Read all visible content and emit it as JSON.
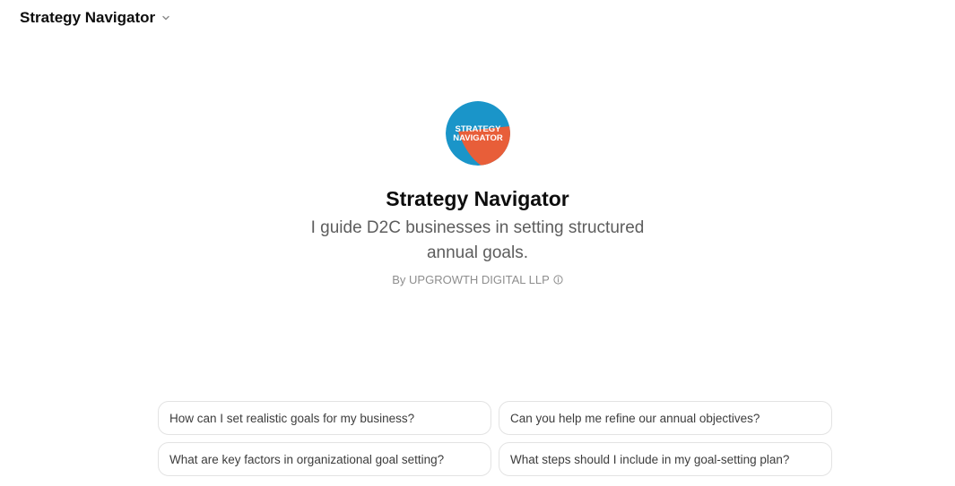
{
  "header": {
    "title": "Strategy Navigator",
    "menu_icon": "chevron-down-icon"
  },
  "gpt": {
    "logo_text_line1": "STRATEGY",
    "logo_text_line2": "NAVIGATOR",
    "logo_colors": {
      "blue": "#1a95c9",
      "orange": "#e85e39"
    },
    "name": "Strategy Navigator",
    "description": "I guide D2C businesses in setting structured annual goals.",
    "byline": "By UPGROWTH DIGITAL LLP",
    "byline_icon": "info-icon"
  },
  "suggestions": [
    {
      "text": "How can I set realistic goals for my business?"
    },
    {
      "text": "Can you help me refine our annual objectives?"
    },
    {
      "text": "What are key factors in organizational goal setting?"
    },
    {
      "text": "What steps should I include in my goal-setting plan?"
    }
  ]
}
